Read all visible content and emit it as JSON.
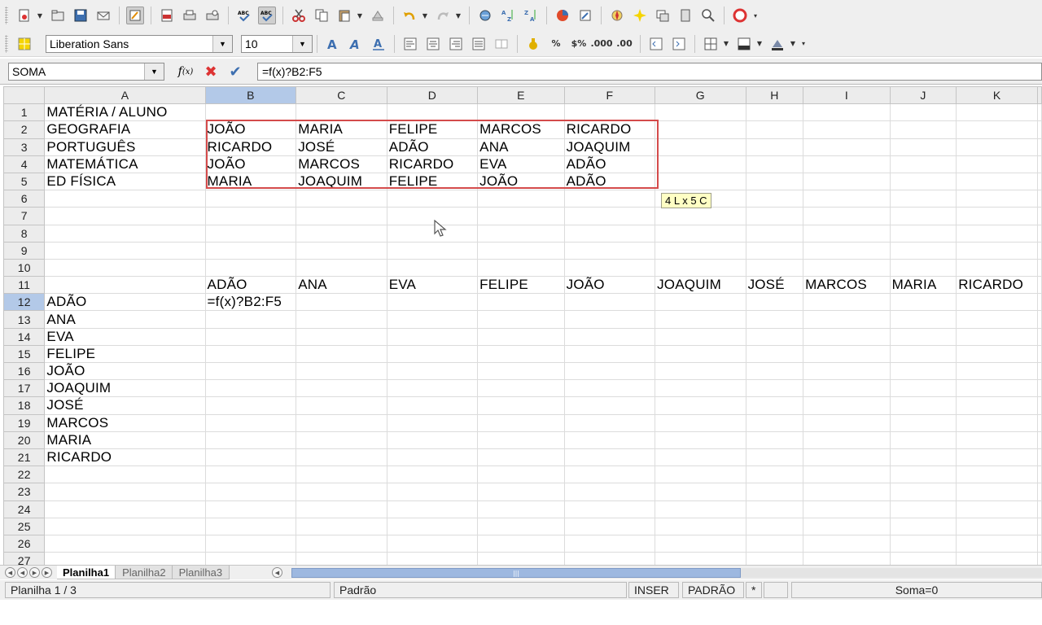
{
  "toolbar1": {
    "buttons": [
      "new-icon",
      "open-icon",
      "save-icon",
      "email-icon",
      "edit-file-icon",
      "export-pdf-icon",
      "print-icon",
      "print-preview-icon",
      "spellcheck-icon",
      "autospell-icon",
      "cut-icon",
      "copy-icon",
      "paste-icon",
      "clone-format-icon",
      "undo-icon",
      "redo-icon",
      "hyperlink-icon",
      "sort-ascending-icon",
      "sort-descending-icon",
      "chart-icon",
      "pivot-icon",
      "navigator-icon",
      "gallery-icon",
      "data-sources-icon",
      "zoom-icon",
      "help-icon"
    ]
  },
  "toolbar2": {
    "font_name": "Liberation Sans",
    "font_size": "10"
  },
  "formula_bar": {
    "name_box": "SOMA",
    "formula": "=f(x)?B2:F5"
  },
  "columns": [
    "A",
    "B",
    "C",
    "D",
    "E",
    "F",
    "G",
    "H",
    "I",
    "J",
    "K"
  ],
  "selected_column": "B",
  "selected_row": "12",
  "rows": [
    {
      "num": "1",
      "cells": [
        "MATÉRIA / ALUNO",
        "",
        "",
        "",
        "",
        "",
        "",
        "",
        "",
        "",
        ""
      ]
    },
    {
      "num": "2",
      "cells": [
        "GEOGRAFIA",
        "JOÃO",
        "MARIA",
        "FELIPE",
        "MARCOS",
        "RICARDO",
        "",
        "",
        "",
        "",
        ""
      ]
    },
    {
      "num": "3",
      "cells": [
        "PORTUGUÊS",
        "RICARDO",
        "JOSÉ",
        "ADÃO",
        "ANA",
        "JOAQUIM",
        "",
        "",
        "",
        "",
        ""
      ]
    },
    {
      "num": "4",
      "cells": [
        "MATEMÁTICA",
        "JOÃO",
        "MARCOS",
        "RICARDO",
        "EVA",
        "ADÃO",
        "",
        "",
        "",
        "",
        ""
      ]
    },
    {
      "num": "5",
      "cells": [
        "ED FÍSICA",
        "MARIA",
        "JOAQUIM",
        "FELIPE",
        "JOÃO",
        "ADÃO",
        "",
        "",
        "",
        "",
        ""
      ]
    },
    {
      "num": "6",
      "cells": [
        "",
        "",
        "",
        "",
        "",
        "",
        "",
        "",
        "",
        "",
        ""
      ]
    },
    {
      "num": "7",
      "cells": [
        "",
        "",
        "",
        "",
        "",
        "",
        "",
        "",
        "",
        "",
        ""
      ]
    },
    {
      "num": "8",
      "cells": [
        "",
        "",
        "",
        "",
        "",
        "",
        "",
        "",
        "",
        "",
        ""
      ]
    },
    {
      "num": "9",
      "cells": [
        "",
        "",
        "",
        "",
        "",
        "",
        "",
        "",
        "",
        "",
        ""
      ]
    },
    {
      "num": "10",
      "cells": [
        "",
        "",
        "",
        "",
        "",
        "",
        "",
        "",
        "",
        "",
        ""
      ]
    },
    {
      "num": "11",
      "cells": [
        "",
        "ADÃO",
        "ANA",
        "EVA",
        "FELIPE",
        "JOÃO",
        "JOAQUIM",
        "JOSÉ",
        "MARCOS",
        "MARIA",
        "RICARDO"
      ]
    },
    {
      "num": "12",
      "cells": [
        "ADÃO",
        "=f(x)?B2:F5",
        "",
        "",
        "",
        "",
        "",
        "",
        "",
        "",
        ""
      ]
    },
    {
      "num": "13",
      "cells": [
        "ANA",
        "",
        "",
        "",
        "",
        "",
        "",
        "",
        "",
        "",
        ""
      ]
    },
    {
      "num": "14",
      "cells": [
        "EVA",
        "",
        "",
        "",
        "",
        "",
        "",
        "",
        "",
        "",
        ""
      ]
    },
    {
      "num": "15",
      "cells": [
        "FELIPE",
        "",
        "",
        "",
        "",
        "",
        "",
        "",
        "",
        "",
        ""
      ]
    },
    {
      "num": "16",
      "cells": [
        "JOÃO",
        "",
        "",
        "",
        "",
        "",
        "",
        "",
        "",
        "",
        ""
      ]
    },
    {
      "num": "17",
      "cells": [
        "JOAQUIM",
        "",
        "",
        "",
        "",
        "",
        "",
        "",
        "",
        "",
        ""
      ]
    },
    {
      "num": "18",
      "cells": [
        "JOSÉ",
        "",
        "",
        "",
        "",
        "",
        "",
        "",
        "",
        "",
        ""
      ]
    },
    {
      "num": "19",
      "cells": [
        "MARCOS",
        "",
        "",
        "",
        "",
        "",
        "",
        "",
        "",
        "",
        ""
      ]
    },
    {
      "num": "20",
      "cells": [
        "MARIA",
        "",
        "",
        "",
        "",
        "",
        "",
        "",
        "",
        "",
        ""
      ]
    },
    {
      "num": "21",
      "cells": [
        "RICARDO",
        "",
        "",
        "",
        "",
        "",
        "",
        "",
        "",
        "",
        ""
      ]
    },
    {
      "num": "22",
      "cells": [
        "",
        "",
        "",
        "",
        "",
        "",
        "",
        "",
        "",
        "",
        ""
      ]
    },
    {
      "num": "23",
      "cells": [
        "",
        "",
        "",
        "",
        "",
        "",
        "",
        "",
        "",
        "",
        ""
      ]
    },
    {
      "num": "24",
      "cells": [
        "",
        "",
        "",
        "",
        "",
        "",
        "",
        "",
        "",
        "",
        ""
      ]
    },
    {
      "num": "25",
      "cells": [
        "",
        "",
        "",
        "",
        "",
        "",
        "",
        "",
        "",
        "",
        ""
      ]
    },
    {
      "num": "26",
      "cells": [
        "",
        "",
        "",
        "",
        "",
        "",
        "",
        "",
        "",
        "",
        ""
      ]
    },
    {
      "num": "27",
      "cells": [
        "",
        "",
        "",
        "",
        "",
        "",
        "",
        "",
        "",
        "",
        ""
      ]
    }
  ],
  "range_tooltip": "4 L x 5 C",
  "sheet_tabs": [
    "Planilha1",
    "Planilha2",
    "Planilha3"
  ],
  "active_sheet": "Planilha1",
  "status": {
    "sheet": "Planilha 1 / 3",
    "style": "Padrão",
    "mode": "INSER",
    "selection": "PADRÃO",
    "modified": "*",
    "sum": "Soma=0"
  },
  "colors": {
    "range_border": "#d44b4b",
    "selected_header": "#b3c9e8",
    "tooltip_bg": "#ffffc4"
  }
}
